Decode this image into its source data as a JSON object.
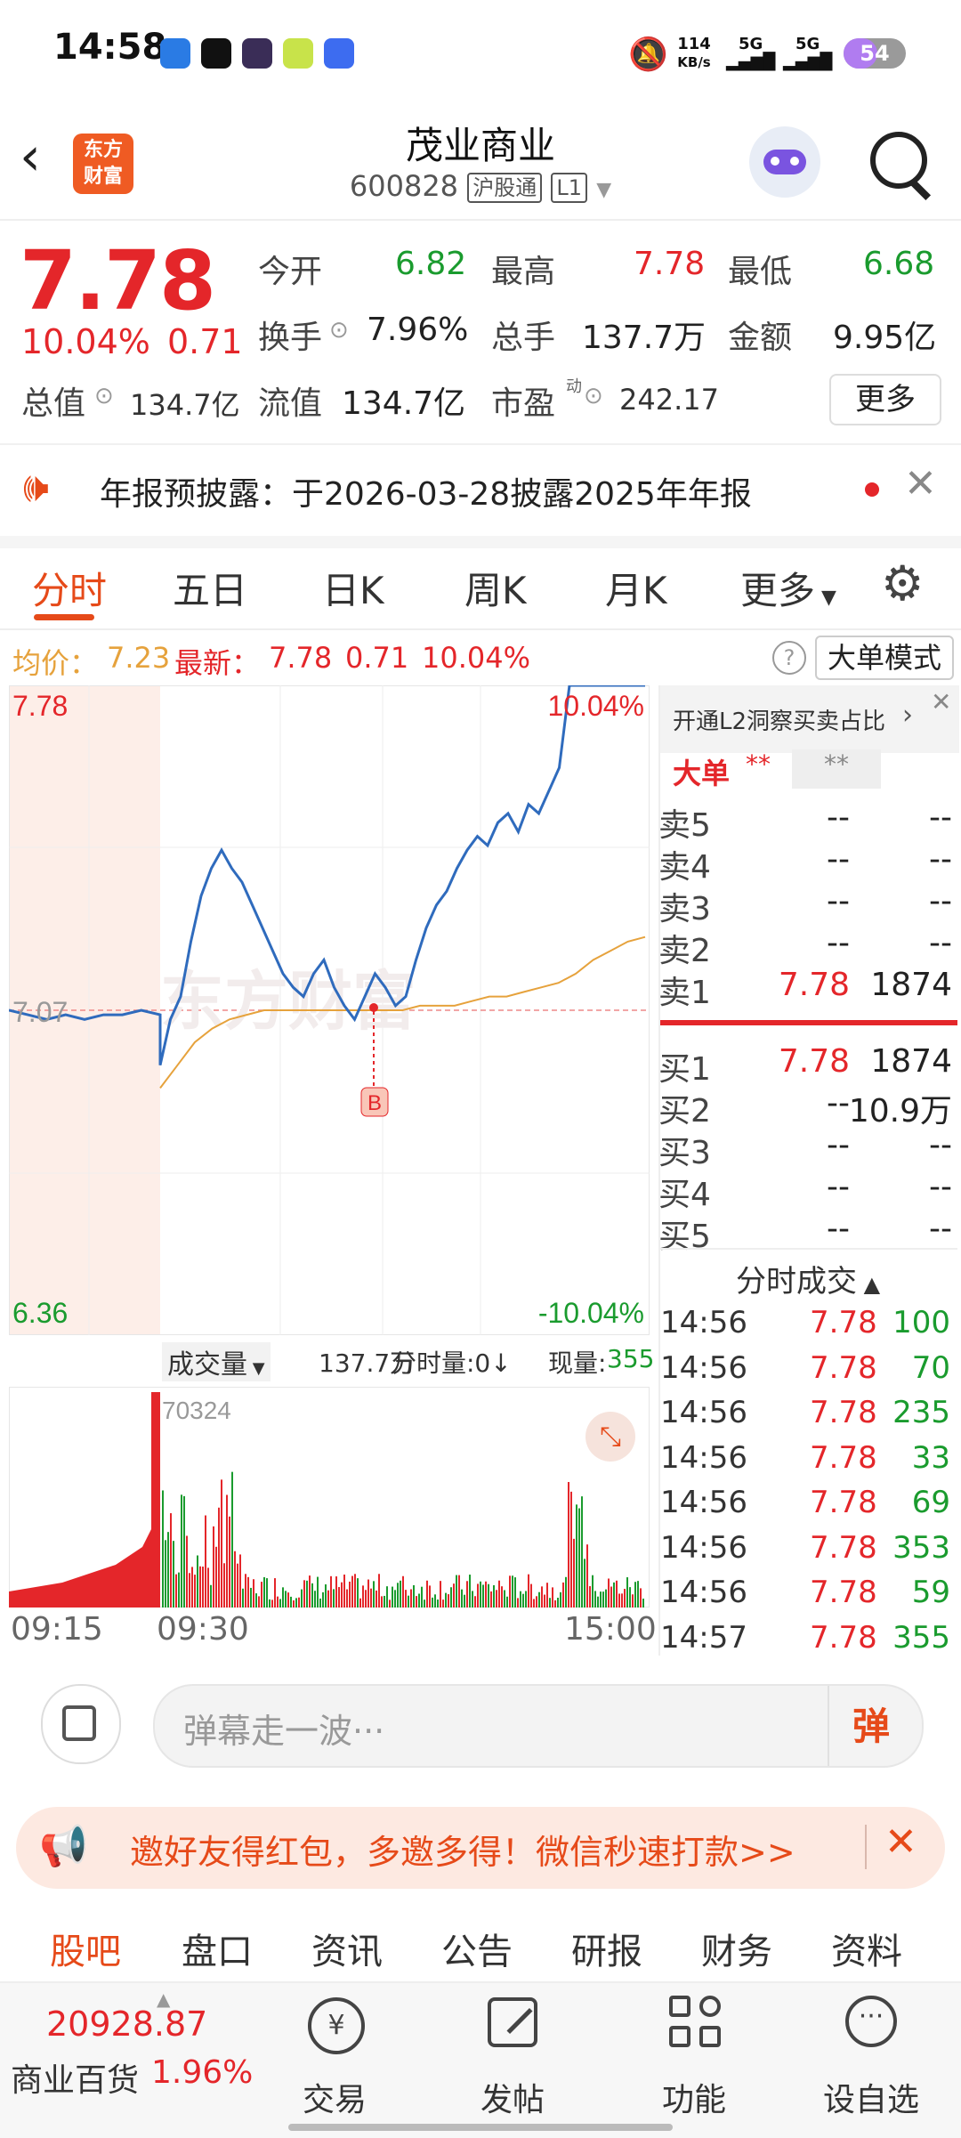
{
  "status_bar": {
    "time": "14:58",
    "net_speed_value": "114",
    "net_speed_unit": "KB/s",
    "signal1": "5G",
    "signal2": "5G",
    "battery": "54"
  },
  "header": {
    "logo_line1": "东方",
    "logo_line2": "财富",
    "stock_name": "茂业商业",
    "stock_code": "600828",
    "tag_market": "沪股通",
    "tag_level": "L1"
  },
  "quote": {
    "price": "7.78",
    "change_pct": "10.04%",
    "change_amt": "0.71",
    "open_label": "今开",
    "open_val": "6.82",
    "high_label": "最高",
    "high_val": "7.78",
    "low_label": "最低",
    "low_val": "6.68",
    "turnover_label": "换手",
    "turnover_val": "7.96%",
    "volume_label": "总手",
    "volume_val": "137.7万",
    "amount_label": "金额",
    "amount_val": "9.95亿",
    "mktcap_label": "总值",
    "mktcap_val": "134.7亿",
    "float_label": "流值",
    "float_val": "134.7亿",
    "pe_label": "市盈",
    "pe_sup": "动",
    "pe_val": "242.17",
    "more_button": "更多"
  },
  "notice": {
    "text": "年报预披露：于2026-03-28披露2025年年报"
  },
  "tabs": [
    "分时",
    "五日",
    "日K",
    "周K",
    "月K",
    "更多"
  ],
  "info_line": {
    "avg_label": "均价：",
    "avg_val": "7.23",
    "latest_label": "最新：",
    "latest_val": "7.78",
    "latest_chg": "0.71",
    "latest_pct": "10.04%",
    "mode_button": "大单模式"
  },
  "chart_labels": {
    "top_price": "7.78",
    "mid_price": "7.07",
    "bottom_price": "6.36",
    "top_pct": "10.04%",
    "bottom_pct": "-10.04%",
    "marker": "B",
    "watermark": "东方财富",
    "vol_selector": "成交量",
    "vol_total": "137.7万",
    "vol_min": "分时量:0↓",
    "vol_now_label": "现量:",
    "vol_now_val": "355",
    "vol_max": "70324",
    "t_start": "09:15",
    "t_open": "09:30",
    "t_end": "15:00"
  },
  "chart_data": {
    "type": "line",
    "ylim": [
      6.36,
      7.78
    ],
    "series": [
      {
        "name": "最新",
        "color": "#2f6bbd",
        "values": [
          7.07,
          7.06,
          7.05,
          7.06,
          7.05,
          7.06,
          7.06,
          7.07,
          7.06,
          6.95,
          7.05,
          7.1,
          7.22,
          7.32,
          7.38,
          7.42,
          7.38,
          7.35,
          7.3,
          7.25,
          7.2,
          7.15,
          7.12,
          7.1,
          7.15,
          7.18,
          7.12,
          7.08,
          7.05,
          7.1,
          7.15,
          7.12,
          7.08,
          7.1,
          7.18,
          7.25,
          7.3,
          7.33,
          7.38,
          7.42,
          7.45,
          7.43,
          7.48,
          7.5,
          7.46,
          7.52,
          7.5,
          7.55,
          7.6,
          7.78
        ]
      },
      {
        "name": "均价",
        "color": "#e6a23c",
        "values": [
          6.9,
          6.95,
          7.0,
          7.03,
          7.05,
          7.06,
          7.07,
          7.07,
          7.07,
          7.07,
          7.07,
          7.07,
          7.07,
          7.07,
          7.07,
          7.08,
          7.08,
          7.08,
          7.09,
          7.1,
          7.1,
          7.11,
          7.12,
          7.13,
          7.15,
          7.18,
          7.2,
          7.22,
          7.23
        ]
      }
    ],
    "x_ticks": [
      "09:15",
      "09:30",
      "15:00"
    ]
  },
  "orderbook": {
    "link_text": "开通L2洞察买卖占比",
    "big_label": "大单",
    "big_val1": "**",
    "big_val2": "**",
    "asks": [
      {
        "label": "卖5",
        "price": "--",
        "vol": "--"
      },
      {
        "label": "卖4",
        "price": "--",
        "vol": "--"
      },
      {
        "label": "卖3",
        "price": "--",
        "vol": "--"
      },
      {
        "label": "卖2",
        "price": "--",
        "vol": "--"
      },
      {
        "label": "卖1",
        "price": "7.78",
        "vol": "1874"
      }
    ],
    "bids": [
      {
        "label": "买1",
        "price": "7.78",
        "vol": "1874"
      },
      {
        "label": "买2",
        "price": "--",
        "vol": "10.9万"
      },
      {
        "label": "买3",
        "price": "--",
        "vol": "--"
      },
      {
        "label": "买4",
        "price": "--",
        "vol": "--"
      },
      {
        "label": "买5",
        "price": "--",
        "vol": "--"
      }
    ],
    "ticks_title": "分时成交",
    "ticks": [
      {
        "t": "14:56",
        "p": "7.78",
        "v": "100"
      },
      {
        "t": "14:56",
        "p": "7.78",
        "v": "70"
      },
      {
        "t": "14:56",
        "p": "7.78",
        "v": "235"
      },
      {
        "t": "14:56",
        "p": "7.78",
        "v": "33"
      },
      {
        "t": "14:56",
        "p": "7.78",
        "v": "69"
      },
      {
        "t": "14:56",
        "p": "7.78",
        "v": "353"
      },
      {
        "t": "14:56",
        "p": "7.78",
        "v": "59"
      },
      {
        "t": "14:57",
        "p": "7.78",
        "v": "355"
      }
    ]
  },
  "danmu": {
    "placeholder": "弹幕走一波···",
    "send_label": "弹"
  },
  "banner": {
    "text": "邀好友得红包，多邀多得！微信秒速打款>>"
  },
  "bottom_tabs": [
    "股吧",
    "盘口",
    "资讯",
    "公告",
    "研报",
    "财务",
    "资料"
  ],
  "footer": {
    "index_value": "20928.87",
    "index_name": "商业百货",
    "index_pct": "1.96%",
    "trade": "交易",
    "post": "发帖",
    "func": "功能",
    "watch": "设自选"
  },
  "colors": {
    "up": "#e4262a",
    "down": "#1a9b2e",
    "accent": "#e64a19",
    "price_line": "#2f6bbd",
    "avg_line": "#e6a23c"
  }
}
